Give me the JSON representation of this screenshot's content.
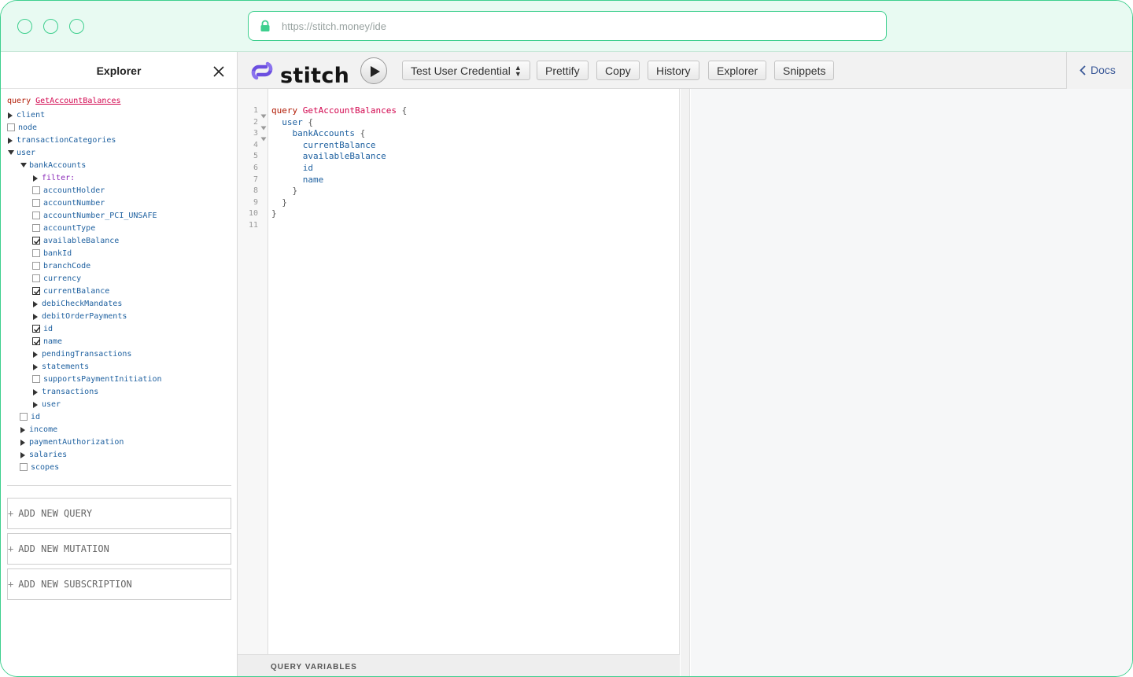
{
  "browser": {
    "url": "https://stitch.money/ide"
  },
  "explorer": {
    "title": "Explorer",
    "operation_keyword": "query",
    "operation_name": "GetAccountBalances",
    "rows": [
      {
        "label": "client",
        "kind": "arrow",
        "open": false,
        "depth": 0
      },
      {
        "label": "node",
        "kind": "checkbox",
        "checked": false,
        "depth": 0
      },
      {
        "label": "transactionCategories",
        "kind": "arrow",
        "open": false,
        "depth": 0
      },
      {
        "label": "user",
        "kind": "arrow",
        "open": true,
        "depth": 0
      },
      {
        "label": "bankAccounts",
        "kind": "arrow",
        "open": true,
        "depth": 1
      },
      {
        "label": "filter:",
        "kind": "arrow",
        "open": false,
        "depth": 2,
        "arg": true
      },
      {
        "label": "accountHolder",
        "kind": "checkbox",
        "checked": false,
        "depth": 2
      },
      {
        "label": "accountNumber",
        "kind": "checkbox",
        "checked": false,
        "depth": 2
      },
      {
        "label": "accountNumber_PCI_UNSAFE",
        "kind": "checkbox",
        "checked": false,
        "depth": 2
      },
      {
        "label": "accountType",
        "kind": "checkbox",
        "checked": false,
        "depth": 2
      },
      {
        "label": "availableBalance",
        "kind": "checkbox",
        "checked": true,
        "depth": 2
      },
      {
        "label": "bankId",
        "kind": "checkbox",
        "checked": false,
        "depth": 2
      },
      {
        "label": "branchCode",
        "kind": "checkbox",
        "checked": false,
        "depth": 2
      },
      {
        "label": "currency",
        "kind": "checkbox",
        "checked": false,
        "depth": 2
      },
      {
        "label": "currentBalance",
        "kind": "checkbox",
        "checked": true,
        "depth": 2
      },
      {
        "label": "debiCheckMandates",
        "kind": "arrow",
        "open": false,
        "depth": 2
      },
      {
        "label": "debitOrderPayments",
        "kind": "arrow",
        "open": false,
        "depth": 2
      },
      {
        "label": "id",
        "kind": "checkbox",
        "checked": true,
        "depth": 2
      },
      {
        "label": "name",
        "kind": "checkbox",
        "checked": true,
        "depth": 2
      },
      {
        "label": "pendingTransactions",
        "kind": "arrow",
        "open": false,
        "depth": 2
      },
      {
        "label": "statements",
        "kind": "arrow",
        "open": false,
        "depth": 2
      },
      {
        "label": "supportsPaymentInitiation",
        "kind": "checkbox",
        "checked": false,
        "depth": 2
      },
      {
        "label": "transactions",
        "kind": "arrow",
        "open": false,
        "depth": 2
      },
      {
        "label": "user",
        "kind": "arrow",
        "open": false,
        "depth": 2
      },
      {
        "label": "id",
        "kind": "checkbox",
        "checked": false,
        "depth": 1
      },
      {
        "label": "income",
        "kind": "arrow",
        "open": false,
        "depth": 1
      },
      {
        "label": "paymentAuthorization",
        "kind": "arrow",
        "open": false,
        "depth": 1
      },
      {
        "label": "salaries",
        "kind": "arrow",
        "open": false,
        "depth": 1
      },
      {
        "label": "scopes",
        "kind": "checkbox",
        "checked": false,
        "depth": 1
      }
    ],
    "add_query": "ADD NEW QUERY",
    "add_mutation": "ADD NEW MUTATION",
    "add_subscription": "ADD NEW SUBSCRIPTION",
    "plus": "+"
  },
  "toolbar": {
    "logo": "stitch",
    "credential": "Test User Credential",
    "prettify": "Prettify",
    "copy": "Copy",
    "history": "History",
    "explorer": "Explorer",
    "snippets": "Snippets",
    "docs": "Docs"
  },
  "editor": {
    "lines": [
      {
        "n": "1",
        "fold": true,
        "tokens": [
          [
            "kw",
            "query"
          ],
          [
            "punc",
            " "
          ],
          [
            "def",
            "GetAccountBalances"
          ],
          [
            "punc",
            " {"
          ]
        ]
      },
      {
        "n": "2",
        "fold": true,
        "tokens": [
          [
            "punc",
            "  "
          ],
          [
            "prop",
            "user"
          ],
          [
            "punc",
            " {"
          ]
        ]
      },
      {
        "n": "3",
        "fold": true,
        "tokens": [
          [
            "punc",
            "    "
          ],
          [
            "prop",
            "bankAccounts"
          ],
          [
            "punc",
            " {"
          ]
        ]
      },
      {
        "n": "4",
        "fold": false,
        "tokens": [
          [
            "punc",
            "      "
          ],
          [
            "prop",
            "currentBalance"
          ]
        ]
      },
      {
        "n": "5",
        "fold": false,
        "tokens": [
          [
            "punc",
            "      "
          ],
          [
            "prop",
            "availableBalance"
          ]
        ]
      },
      {
        "n": "6",
        "fold": false,
        "tokens": [
          [
            "punc",
            "      "
          ],
          [
            "prop",
            "id"
          ]
        ]
      },
      {
        "n": "7",
        "fold": false,
        "tokens": [
          [
            "punc",
            "      "
          ],
          [
            "prop",
            "name"
          ]
        ]
      },
      {
        "n": "8",
        "fold": false,
        "tokens": [
          [
            "punc",
            "    }"
          ]
        ]
      },
      {
        "n": "9",
        "fold": false,
        "tokens": [
          [
            "punc",
            "  }"
          ]
        ]
      },
      {
        "n": "10",
        "fold": false,
        "tokens": [
          [
            "punc",
            "}"
          ]
        ]
      },
      {
        "n": "11",
        "fold": false,
        "tokens": []
      }
    ],
    "query_variables_label": "QUERY VARIABLES"
  },
  "colors": {
    "accent": "#3ecf8e",
    "logo": "#6c4fe0",
    "keyword": "#b11a04",
    "definition": "#d2054e",
    "property": "#1f61a0"
  }
}
